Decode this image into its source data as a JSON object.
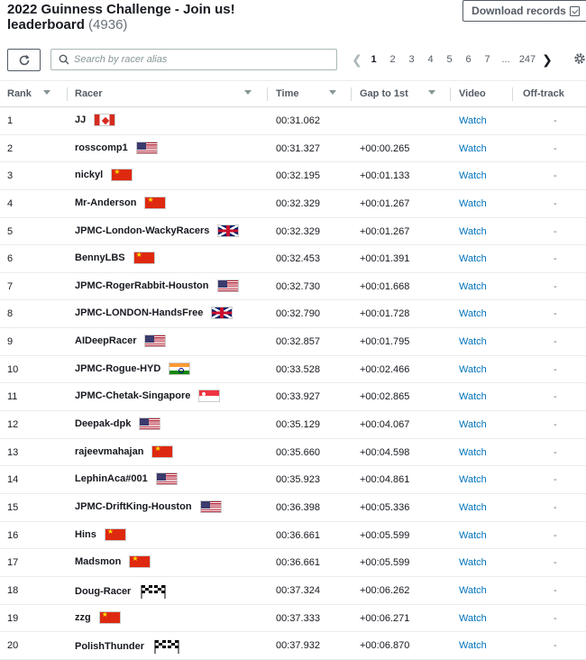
{
  "header": {
    "title": "2022 Guinness Challenge - Join us!",
    "subtitle": "leaderboard",
    "count": "(4936)",
    "download_label": "Download records"
  },
  "toolbar": {
    "search_placeholder": "Search by racer alias",
    "pages": [
      "1",
      "2",
      "3",
      "4",
      "5",
      "6",
      "7",
      "...",
      "247"
    ],
    "active_page": "1"
  },
  "columns": {
    "rank": "Rank",
    "racer": "Racer",
    "time": "Time",
    "gap": "Gap to 1st",
    "video": "Video",
    "offtrack": "Off-track"
  },
  "colors": {
    "link": "#0073bb",
    "text": "#16191f",
    "border": "#eaeded"
  },
  "rows": [
    {
      "rank": "1",
      "racer": "JJ",
      "flag": "ca",
      "time": "00:31.062",
      "gap": "",
      "video": "Watch",
      "offtrack": "-"
    },
    {
      "rank": "2",
      "racer": "rosscomp1",
      "flag": "us",
      "time": "00:31.327",
      "gap": "+00:00.265",
      "video": "Watch",
      "offtrack": "-"
    },
    {
      "rank": "3",
      "racer": "nickyl",
      "flag": "cn",
      "time": "00:32.195",
      "gap": "+00:01.133",
      "video": "Watch",
      "offtrack": "-"
    },
    {
      "rank": "4",
      "racer": "Mr-Anderson",
      "flag": "cn",
      "time": "00:32.329",
      "gap": "+00:01.267",
      "video": "Watch",
      "offtrack": "-"
    },
    {
      "rank": "5",
      "racer": "JPMC-London-WackyRacers",
      "flag": "gb",
      "time": "00:32.329",
      "gap": "+00:01.267",
      "video": "Watch",
      "offtrack": "-"
    },
    {
      "rank": "6",
      "racer": "BennyLBS",
      "flag": "cn",
      "time": "00:32.453",
      "gap": "+00:01.391",
      "video": "Watch",
      "offtrack": "-"
    },
    {
      "rank": "7",
      "racer": "JPMC-RogerRabbit-Houston",
      "flag": "us",
      "time": "00:32.730",
      "gap": "+00:01.668",
      "video": "Watch",
      "offtrack": "-"
    },
    {
      "rank": "8",
      "racer": "JPMC-LONDON-HandsFree",
      "flag": "gb",
      "time": "00:32.790",
      "gap": "+00:01.728",
      "video": "Watch",
      "offtrack": "-"
    },
    {
      "rank": "9",
      "racer": "AIDeepRacer",
      "flag": "us",
      "time": "00:32.857",
      "gap": "+00:01.795",
      "video": "Watch",
      "offtrack": "-"
    },
    {
      "rank": "10",
      "racer": "JPMC-Rogue-HYD",
      "flag": "in",
      "time": "00:33.528",
      "gap": "+00:02.466",
      "video": "Watch",
      "offtrack": "-"
    },
    {
      "rank": "11",
      "racer": "JPMC-Chetak-Singapore",
      "flag": "sg",
      "time": "00:33.927",
      "gap": "+00:02.865",
      "video": "Watch",
      "offtrack": "-"
    },
    {
      "rank": "12",
      "racer": "Deepak-dpk",
      "flag": "us",
      "time": "00:35.129",
      "gap": "+00:04.067",
      "video": "Watch",
      "offtrack": "-"
    },
    {
      "rank": "13",
      "racer": "rajeevmahajan",
      "flag": "cn",
      "time": "00:35.660",
      "gap": "+00:04.598",
      "video": "Watch",
      "offtrack": "-"
    },
    {
      "rank": "14",
      "racer": "LephinAca#001",
      "flag": "us",
      "time": "00:35.923",
      "gap": "+00:04.861",
      "video": "Watch",
      "offtrack": "-"
    },
    {
      "rank": "15",
      "racer": "JPMC-DriftKing-Houston",
      "flag": "us",
      "time": "00:36.398",
      "gap": "+00:05.336",
      "video": "Watch",
      "offtrack": "-"
    },
    {
      "rank": "16",
      "racer": "Hins",
      "flag": "cn",
      "time": "00:36.661",
      "gap": "+00:05.599",
      "video": "Watch",
      "offtrack": "-"
    },
    {
      "rank": "17",
      "racer": "Madsmon",
      "flag": "cn",
      "time": "00:36.661",
      "gap": "+00:05.599",
      "video": "Watch",
      "offtrack": "-"
    },
    {
      "rank": "18",
      "racer": "Doug-Racer",
      "flag": "chk",
      "time": "00:37.324",
      "gap": "+00:06.262",
      "video": "Watch",
      "offtrack": "-"
    },
    {
      "rank": "19",
      "racer": "zzg",
      "flag": "cn",
      "time": "00:37.333",
      "gap": "+00:06.271",
      "video": "Watch",
      "offtrack": "-"
    },
    {
      "rank": "20",
      "racer": "PolishThunder",
      "flag": "chk",
      "time": "00:37.932",
      "gap": "+00:06.870",
      "video": "Watch",
      "offtrack": "-"
    }
  ]
}
